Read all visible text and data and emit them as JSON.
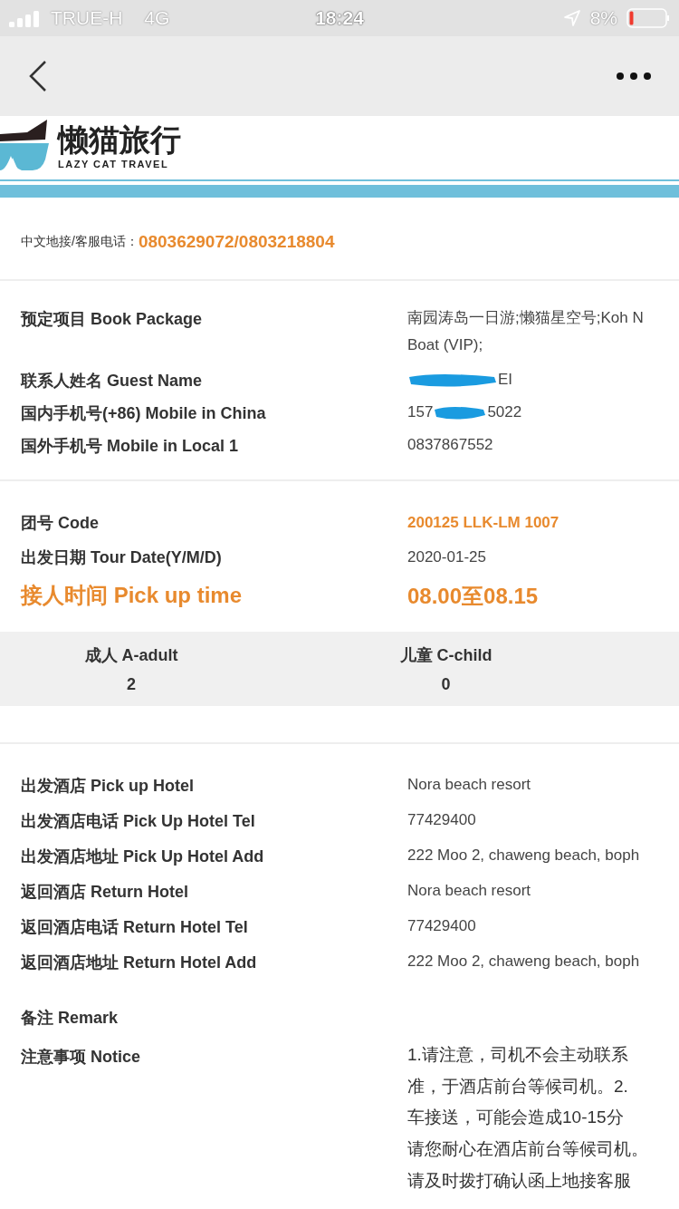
{
  "status_bar": {
    "carrier": "TRUE-H",
    "network": "4G",
    "time": "18:24",
    "battery": "8%",
    "battery_low": true
  },
  "logo": {
    "name": "懒猫旅行",
    "subtitle": "LAZY CAT TRAVEL"
  },
  "hotline": {
    "label": "中文地接/客服电话：",
    "value": "0803629072/0803218804"
  },
  "booking": [
    {
      "label": "预定项目 Book Package",
      "lines": [
        "南园涛岛一日游;懒猫星空号;Koh N",
        "Boat (VIP);"
      ]
    },
    {
      "label": "联系人姓名 Guest Name",
      "after": "EI",
      "redacted": true
    },
    {
      "label": "国内手机号(+86) Mobile in China",
      "before": "157",
      "after": "5022",
      "redacted": true
    },
    {
      "label": "国外手机号 Mobile in Local 1",
      "lines": [
        "0837867552"
      ]
    }
  ],
  "tour": [
    {
      "label": "团号 Code",
      "value": "200125 LLK-LM 1007",
      "kind": "highlight"
    },
    {
      "label": "出发日期 Tour Date(Y/M/D)",
      "value": "2020-01-25",
      "kind": "normal"
    },
    {
      "label": "接人时间 Pick up time",
      "value": "08.00至08.15",
      "kind": "emphasis"
    }
  ],
  "counts": [
    {
      "label": "成人 A-adult",
      "value": "2"
    },
    {
      "label": "儿童 C-child",
      "value": "0"
    }
  ],
  "hotels": [
    {
      "label": "出发酒店 Pick up Hotel",
      "value": "Nora beach resort"
    },
    {
      "label": "出发酒店电话 Pick Up Hotel Tel",
      "value": "77429400"
    },
    {
      "label": "出发酒店地址 Pick Up Hotel Add",
      "value": "222 Moo 2, chaweng beach, boph"
    },
    {
      "label": "返回酒店 Return Hotel",
      "value": "Nora beach resort"
    },
    {
      "label": "返回酒店电话 Return Hotel Tel",
      "value": "77429400"
    },
    {
      "label": "返回酒店地址 Return Hotel Add",
      "value": "222 Moo 2, chaweng beach, boph"
    }
  ],
  "remark": {
    "label": "备注 Remark"
  },
  "notice": {
    "label": "注意事项 Notice",
    "lines": [
      "1.请注意，司机不会主动联系",
      "准，于酒店前台等候司机。2.",
      "车接送，可能会造成10-15分",
      "请您耐心在酒店前台等候司机。",
      "请及时拨打确认函上地接客服"
    ]
  }
}
